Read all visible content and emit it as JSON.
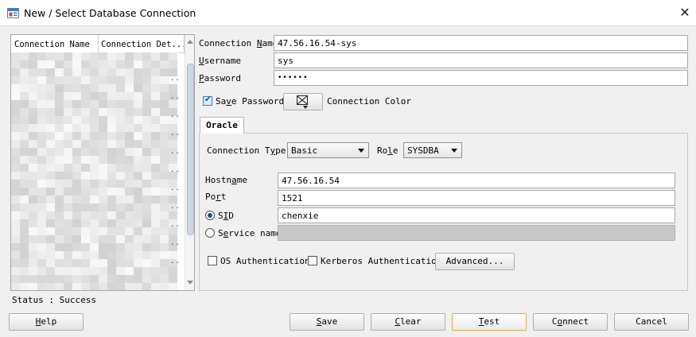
{
  "window": {
    "title": "New / Select Database Connection",
    "close_glyph": "✕",
    "icon": "database-icon"
  },
  "connections_list": {
    "columns": [
      "Connection Name",
      "Connection Det..."
    ],
    "rows_obscured": true,
    "ellipsis": ".."
  },
  "status": {
    "text": "Status : Success"
  },
  "form": {
    "connection_name": {
      "label": "Connection Name",
      "value": "47.56.16.54-sys"
    },
    "username": {
      "label": "Username",
      "value": "sys"
    },
    "password": {
      "label": "Password",
      "value": "••••••"
    },
    "save_password": {
      "label": "Save Password",
      "checked": true
    },
    "connection_color": {
      "label": "Connection Color"
    }
  },
  "tabs": [
    {
      "label": "Oracle",
      "active": true
    }
  ],
  "oracle": {
    "connection_type": {
      "label": "Connection Type",
      "value": "Basic"
    },
    "role": {
      "label": "Role",
      "value": "SYSDBA"
    },
    "hostname": {
      "label": "Hostname",
      "value": "47.56.16.54"
    },
    "port": {
      "label": "Port",
      "value": "1521"
    },
    "sid": {
      "label": "SID",
      "value": "chenxie",
      "selected": true
    },
    "service_name": {
      "label": "Service name",
      "value": "",
      "selected": false
    },
    "os_auth": {
      "label": "OS Authentication",
      "checked": false
    },
    "kerberos_auth": {
      "label": "Kerberos Authentication",
      "checked": false
    },
    "advanced_button": "Advanced..."
  },
  "buttons": {
    "help": "Help",
    "save": "Save",
    "clear": "Clear",
    "test": "Test",
    "connect": "Connect",
    "cancel": "Cancel"
  },
  "colors": {
    "window_bg": "#f0f0f0",
    "focus_border": "#e8a34a",
    "disabled_field": "#c8c8c8"
  }
}
